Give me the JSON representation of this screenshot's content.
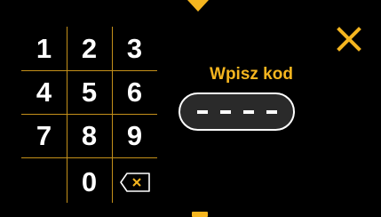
{
  "keypad": {
    "keys": [
      "1",
      "2",
      "3",
      "4",
      "5",
      "6",
      "7",
      "8",
      "9",
      "0"
    ],
    "backspace_icon": "backspace-x-icon"
  },
  "prompt": {
    "label": "Wpisz kod",
    "code_placeholder": "- - - -",
    "digits_entered": 0,
    "digits_total": 4
  },
  "icons": {
    "close": "close-x-icon",
    "top_arrow": "triangle-down-icon",
    "bottom_marker": "bar-icon"
  },
  "colors": {
    "accent": "#f5b51f",
    "grid": "#c4901a",
    "text": "#ffffff",
    "background": "#000000",
    "field_fill": "#2a2a2a"
  }
}
